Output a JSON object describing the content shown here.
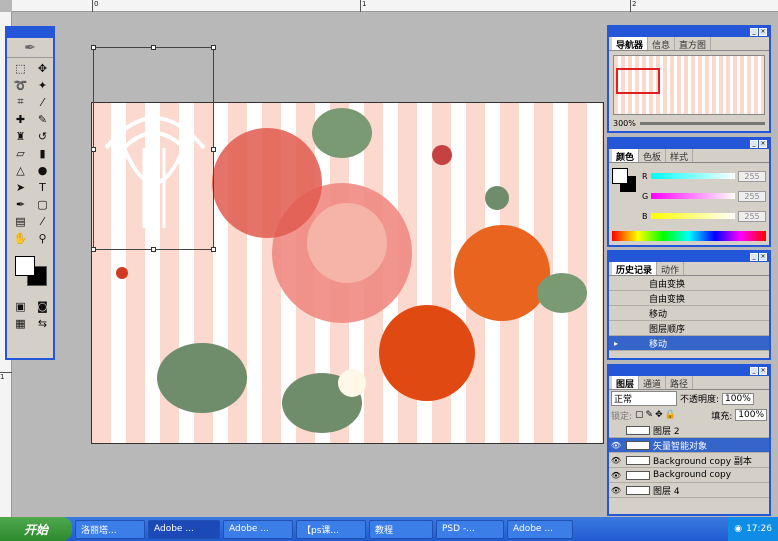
{
  "ruler": {
    "top_labels": [
      "0",
      "1",
      "2"
    ],
    "left_labels": [
      "1"
    ]
  },
  "toolbox": {
    "tools": [
      "marquee-icon",
      "move-icon",
      "lasso-icon",
      "magic-wand-icon",
      "crop-icon",
      "slice-icon",
      "healing-icon",
      "brush-icon",
      "stamp-icon",
      "history-brush-icon",
      "eraser-icon",
      "gradient-icon",
      "blur-icon",
      "dodge-icon",
      "path-select-icon",
      "type-icon",
      "pen-icon",
      "shape-icon",
      "notes-icon",
      "eyedropper-icon",
      "hand-icon",
      "zoom-icon"
    ],
    "text_tool_label": "T"
  },
  "navigator": {
    "tabs": [
      "导航器",
      "信息",
      "直方图"
    ],
    "zoom": "300%"
  },
  "color": {
    "tabs": [
      "颜色",
      "色板",
      "样式"
    ],
    "channels": [
      {
        "name": "R",
        "value": "255"
      },
      {
        "name": "G",
        "value": "255"
      },
      {
        "name": "B",
        "value": "255"
      }
    ]
  },
  "history": {
    "tabs": [
      "历史记录",
      "动作"
    ],
    "items": [
      "自由变换",
      "自由变换",
      "移动",
      "图层顺序",
      "移动"
    ]
  },
  "layers": {
    "tabs": [
      "图层",
      "通道",
      "路径"
    ],
    "blend_mode": "正常",
    "opacity_label": "不透明度:",
    "opacity": "100%",
    "lock_label": "锁定:",
    "fill_label": "填充:",
    "fill": "100%",
    "items": [
      "图层 2",
      "矢量智能对象",
      "Background copy 副本",
      "Background copy",
      "图层 4"
    ]
  },
  "taskbar": {
    "start": "开始",
    "tasks": [
      "洛丽塔...",
      "Adobe ...",
      "Adobe ...",
      "【ps课...",
      "教程",
      "PSD -...",
      "Adobe ..."
    ],
    "clock": "17:26"
  }
}
